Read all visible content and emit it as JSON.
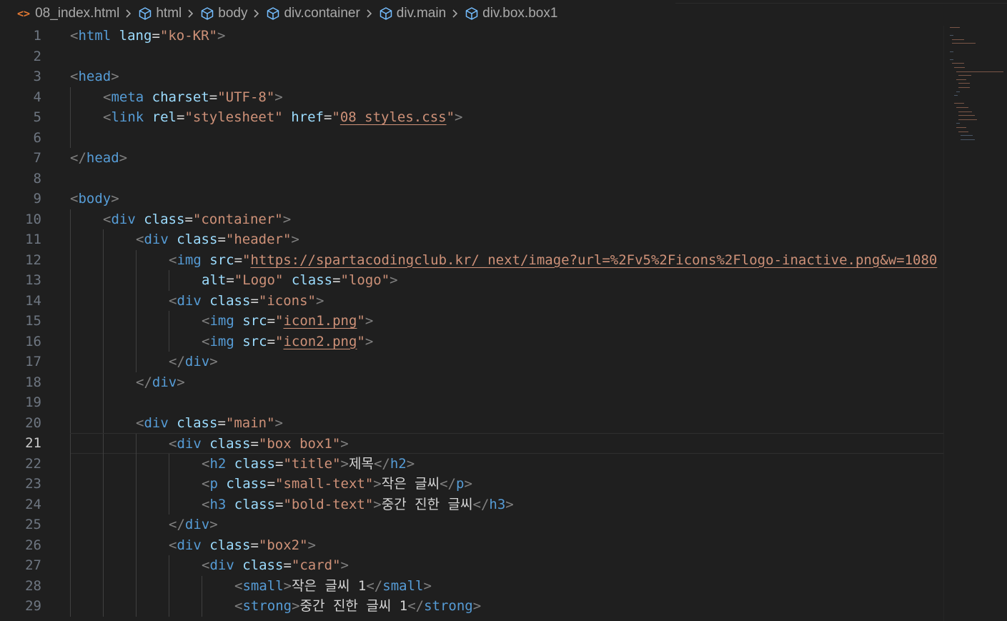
{
  "breadcrumb": {
    "file": "08_index.html",
    "items": [
      "html",
      "body",
      "div.container",
      "div.main",
      "div.box.box1"
    ],
    "file_icon": "<>",
    "element_icon": "cube-icon"
  },
  "editor": {
    "current_line": 21,
    "lines": [
      {
        "n": "1",
        "indent": 0,
        "tokens": [
          {
            "t": "<",
            "c": "punct"
          },
          {
            "t": "html",
            "c": "tag"
          },
          {
            "t": " ",
            "c": "text"
          },
          {
            "t": "lang",
            "c": "attr"
          },
          {
            "t": "=",
            "c": "eq"
          },
          {
            "t": "\"ko-KR\"",
            "c": "str"
          },
          {
            "t": ">",
            "c": "punct"
          }
        ]
      },
      {
        "n": "2",
        "indent": 0,
        "tokens": []
      },
      {
        "n": "3",
        "indent": 0,
        "tokens": [
          {
            "t": "<",
            "c": "punct"
          },
          {
            "t": "head",
            "c": "tag"
          },
          {
            "t": ">",
            "c": "punct"
          }
        ]
      },
      {
        "n": "4",
        "indent": 1,
        "tokens": [
          {
            "t": "<",
            "c": "punct"
          },
          {
            "t": "meta",
            "c": "tag"
          },
          {
            "t": " ",
            "c": "text"
          },
          {
            "t": "charset",
            "c": "attr"
          },
          {
            "t": "=",
            "c": "eq"
          },
          {
            "t": "\"UTF-8\"",
            "c": "str"
          },
          {
            "t": ">",
            "c": "punct"
          }
        ]
      },
      {
        "n": "5",
        "indent": 1,
        "tokens": [
          {
            "t": "<",
            "c": "punct"
          },
          {
            "t": "link",
            "c": "tag"
          },
          {
            "t": " ",
            "c": "text"
          },
          {
            "t": "rel",
            "c": "attr"
          },
          {
            "t": "=",
            "c": "eq"
          },
          {
            "t": "\"stylesheet\"",
            "c": "str"
          },
          {
            "t": " ",
            "c": "text"
          },
          {
            "t": "href",
            "c": "attr"
          },
          {
            "t": "=",
            "c": "eq"
          },
          {
            "t": "\"",
            "c": "str"
          },
          {
            "t": "08_styles.css",
            "c": "link"
          },
          {
            "t": "\"",
            "c": "str"
          },
          {
            "t": ">",
            "c": "punct"
          }
        ]
      },
      {
        "n": "6",
        "indent": 1,
        "tokens": []
      },
      {
        "n": "7",
        "indent": 0,
        "tokens": [
          {
            "t": "</",
            "c": "punct"
          },
          {
            "t": "head",
            "c": "tag"
          },
          {
            "t": ">",
            "c": "punct"
          }
        ]
      },
      {
        "n": "8",
        "indent": 0,
        "tokens": []
      },
      {
        "n": "9",
        "indent": 0,
        "tokens": [
          {
            "t": "<",
            "c": "punct"
          },
          {
            "t": "body",
            "c": "tag"
          },
          {
            "t": ">",
            "c": "punct"
          }
        ]
      },
      {
        "n": "10",
        "indent": 1,
        "tokens": [
          {
            "t": "<",
            "c": "punct"
          },
          {
            "t": "div",
            "c": "tag"
          },
          {
            "t": " ",
            "c": "text"
          },
          {
            "t": "class",
            "c": "attr"
          },
          {
            "t": "=",
            "c": "eq"
          },
          {
            "t": "\"container\"",
            "c": "str"
          },
          {
            "t": ">",
            "c": "punct"
          }
        ]
      },
      {
        "n": "11",
        "indent": 2,
        "tokens": [
          {
            "t": "<",
            "c": "punct"
          },
          {
            "t": "div",
            "c": "tag"
          },
          {
            "t": " ",
            "c": "text"
          },
          {
            "t": "class",
            "c": "attr"
          },
          {
            "t": "=",
            "c": "eq"
          },
          {
            "t": "\"header\"",
            "c": "str"
          },
          {
            "t": ">",
            "c": "punct"
          }
        ]
      },
      {
        "n": "12",
        "indent": 3,
        "tokens": [
          {
            "t": "<",
            "c": "punct"
          },
          {
            "t": "img",
            "c": "tag"
          },
          {
            "t": " ",
            "c": "text"
          },
          {
            "t": "src",
            "c": "attr"
          },
          {
            "t": "=",
            "c": "eq"
          },
          {
            "t": "\"",
            "c": "str"
          },
          {
            "t": "https://spartacodingclub.kr/_next/image?url=%2Fv5%2Ficons%2Flogo-inactive.png&w=1080",
            "c": "link"
          }
        ]
      },
      {
        "n": "13",
        "indent": 4,
        "tokens": [
          {
            "t": "alt",
            "c": "attr"
          },
          {
            "t": "=",
            "c": "eq"
          },
          {
            "t": "\"Logo\"",
            "c": "str"
          },
          {
            "t": " ",
            "c": "text"
          },
          {
            "t": "class",
            "c": "attr"
          },
          {
            "t": "=",
            "c": "eq"
          },
          {
            "t": "\"logo\"",
            "c": "str"
          },
          {
            "t": ">",
            "c": "punct"
          }
        ]
      },
      {
        "n": "14",
        "indent": 3,
        "tokens": [
          {
            "t": "<",
            "c": "punct"
          },
          {
            "t": "div",
            "c": "tag"
          },
          {
            "t": " ",
            "c": "text"
          },
          {
            "t": "class",
            "c": "attr"
          },
          {
            "t": "=",
            "c": "eq"
          },
          {
            "t": "\"icons\"",
            "c": "str"
          },
          {
            "t": ">",
            "c": "punct"
          }
        ]
      },
      {
        "n": "15",
        "indent": 4,
        "tokens": [
          {
            "t": "<",
            "c": "punct"
          },
          {
            "t": "img",
            "c": "tag"
          },
          {
            "t": " ",
            "c": "text"
          },
          {
            "t": "src",
            "c": "attr"
          },
          {
            "t": "=",
            "c": "eq"
          },
          {
            "t": "\"",
            "c": "str"
          },
          {
            "t": "icon1.png",
            "c": "link"
          },
          {
            "t": "\"",
            "c": "str"
          },
          {
            "t": ">",
            "c": "punct"
          }
        ]
      },
      {
        "n": "16",
        "indent": 4,
        "tokens": [
          {
            "t": "<",
            "c": "punct"
          },
          {
            "t": "img",
            "c": "tag"
          },
          {
            "t": " ",
            "c": "text"
          },
          {
            "t": "src",
            "c": "attr"
          },
          {
            "t": "=",
            "c": "eq"
          },
          {
            "t": "\"",
            "c": "str"
          },
          {
            "t": "icon2.png",
            "c": "link"
          },
          {
            "t": "\"",
            "c": "str"
          },
          {
            "t": ">",
            "c": "punct"
          }
        ]
      },
      {
        "n": "17",
        "indent": 3,
        "tokens": [
          {
            "t": "</",
            "c": "punct"
          },
          {
            "t": "div",
            "c": "tag"
          },
          {
            "t": ">",
            "c": "punct"
          }
        ]
      },
      {
        "n": "18",
        "indent": 2,
        "tokens": [
          {
            "t": "</",
            "c": "punct"
          },
          {
            "t": "div",
            "c": "tag"
          },
          {
            "t": ">",
            "c": "punct"
          }
        ]
      },
      {
        "n": "19",
        "indent": 2,
        "tokens": []
      },
      {
        "n": "20",
        "indent": 2,
        "tokens": [
          {
            "t": "<",
            "c": "punct"
          },
          {
            "t": "div",
            "c": "tag"
          },
          {
            "t": " ",
            "c": "text"
          },
          {
            "t": "class",
            "c": "attr"
          },
          {
            "t": "=",
            "c": "eq"
          },
          {
            "t": "\"main\"",
            "c": "str"
          },
          {
            "t": ">",
            "c": "punct"
          }
        ]
      },
      {
        "n": "21",
        "indent": 3,
        "tokens": [
          {
            "t": "<",
            "c": "punct"
          },
          {
            "t": "div",
            "c": "tag"
          },
          {
            "t": " ",
            "c": "text"
          },
          {
            "t": "class",
            "c": "attr"
          },
          {
            "t": "=",
            "c": "eq"
          },
          {
            "t": "\"box box1\"",
            "c": "str"
          },
          {
            "t": ">",
            "c": "punct"
          }
        ]
      },
      {
        "n": "22",
        "indent": 4,
        "tokens": [
          {
            "t": "<",
            "c": "punct"
          },
          {
            "t": "h2",
            "c": "tag"
          },
          {
            "t": " ",
            "c": "text"
          },
          {
            "t": "class",
            "c": "attr"
          },
          {
            "t": "=",
            "c": "eq"
          },
          {
            "t": "\"title\"",
            "c": "str"
          },
          {
            "t": ">",
            "c": "punct"
          },
          {
            "t": "제목",
            "c": "text"
          },
          {
            "t": "</",
            "c": "punct"
          },
          {
            "t": "h2",
            "c": "tag"
          },
          {
            "t": ">",
            "c": "punct"
          }
        ]
      },
      {
        "n": "23",
        "indent": 4,
        "tokens": [
          {
            "t": "<",
            "c": "punct"
          },
          {
            "t": "p",
            "c": "tag"
          },
          {
            "t": " ",
            "c": "text"
          },
          {
            "t": "class",
            "c": "attr"
          },
          {
            "t": "=",
            "c": "eq"
          },
          {
            "t": "\"small-text\"",
            "c": "str"
          },
          {
            "t": ">",
            "c": "punct"
          },
          {
            "t": "작은 글씨",
            "c": "text"
          },
          {
            "t": "</",
            "c": "punct"
          },
          {
            "t": "p",
            "c": "tag"
          },
          {
            "t": ">",
            "c": "punct"
          }
        ]
      },
      {
        "n": "24",
        "indent": 4,
        "tokens": [
          {
            "t": "<",
            "c": "punct"
          },
          {
            "t": "h3",
            "c": "tag"
          },
          {
            "t": " ",
            "c": "text"
          },
          {
            "t": "class",
            "c": "attr"
          },
          {
            "t": "=",
            "c": "eq"
          },
          {
            "t": "\"bold-text\"",
            "c": "str"
          },
          {
            "t": ">",
            "c": "punct"
          },
          {
            "t": "중간 진한 글씨",
            "c": "text"
          },
          {
            "t": "</",
            "c": "punct"
          },
          {
            "t": "h3",
            "c": "tag"
          },
          {
            "t": ">",
            "c": "punct"
          }
        ]
      },
      {
        "n": "25",
        "indent": 3,
        "tokens": [
          {
            "t": "</",
            "c": "punct"
          },
          {
            "t": "div",
            "c": "tag"
          },
          {
            "t": ">",
            "c": "punct"
          }
        ]
      },
      {
        "n": "26",
        "indent": 3,
        "tokens": [
          {
            "t": "<",
            "c": "punct"
          },
          {
            "t": "div",
            "c": "tag"
          },
          {
            "t": " ",
            "c": "text"
          },
          {
            "t": "class",
            "c": "attr"
          },
          {
            "t": "=",
            "c": "eq"
          },
          {
            "t": "\"box2\"",
            "c": "str"
          },
          {
            "t": ">",
            "c": "punct"
          }
        ]
      },
      {
        "n": "27",
        "indent": 4,
        "tokens": [
          {
            "t": "<",
            "c": "punct"
          },
          {
            "t": "div",
            "c": "tag"
          },
          {
            "t": " ",
            "c": "text"
          },
          {
            "t": "class",
            "c": "attr"
          },
          {
            "t": "=",
            "c": "eq"
          },
          {
            "t": "\"card\"",
            "c": "str"
          },
          {
            "t": ">",
            "c": "punct"
          }
        ]
      },
      {
        "n": "28",
        "indent": 5,
        "tokens": [
          {
            "t": "<",
            "c": "punct"
          },
          {
            "t": "small",
            "c": "tag"
          },
          {
            "t": ">",
            "c": "punct"
          },
          {
            "t": "작은 글씨 1",
            "c": "text"
          },
          {
            "t": "</",
            "c": "punct"
          },
          {
            "t": "small",
            "c": "tag"
          },
          {
            "t": ">",
            "c": "punct"
          }
        ]
      },
      {
        "n": "29",
        "indent": 5,
        "tokens": [
          {
            "t": "<",
            "c": "punct"
          },
          {
            "t": "strong",
            "c": "tag"
          },
          {
            "t": ">",
            "c": "punct"
          },
          {
            "t": "중간 진한 글씨 1",
            "c": "text"
          },
          {
            "t": "</",
            "c": "punct"
          },
          {
            "t": "strong",
            "c": "tag"
          },
          {
            "t": ">",
            "c": "punct"
          }
        ]
      }
    ]
  },
  "colors": {
    "background": "#1f1f1f",
    "tag": "#569cd6",
    "attribute": "#9cdcfe",
    "string": "#ce9178",
    "punctuation": "#808080",
    "line_number": "#6e7681",
    "file_icon": "#e37933"
  }
}
